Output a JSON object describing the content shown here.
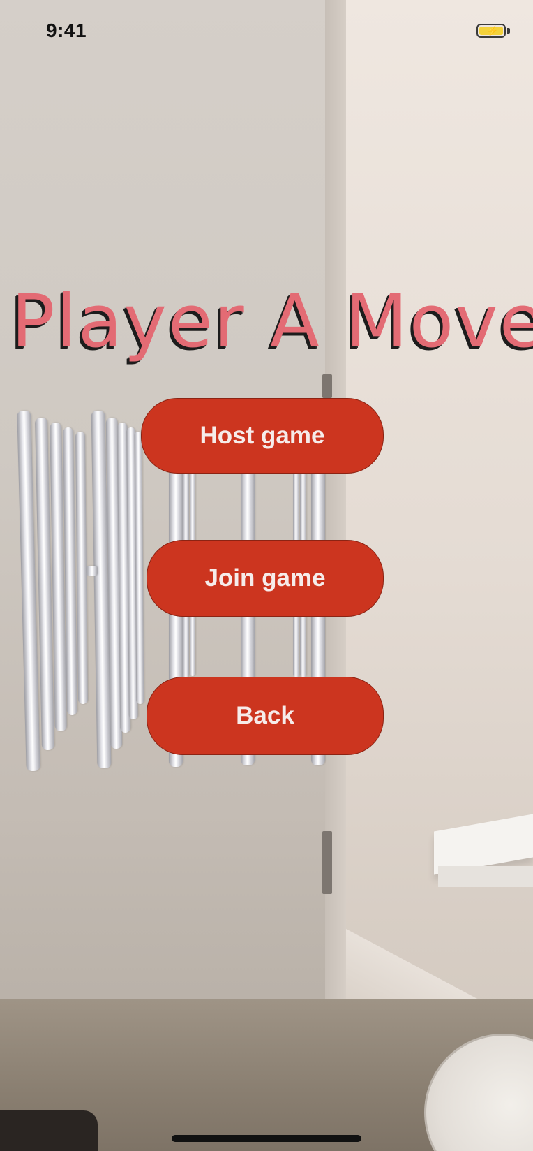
{
  "status_bar": {
    "time": "9:41",
    "battery_icon": "battery-charging-icon",
    "battery_color": "#f4d23a"
  },
  "title": "Player A Move",
  "buttons": {
    "host": "Host game",
    "join": "Join game",
    "back": "Back"
  },
  "colors": {
    "title": "#e36b74",
    "button_bg": "#cc351f",
    "button_text": "#f6ecea"
  }
}
